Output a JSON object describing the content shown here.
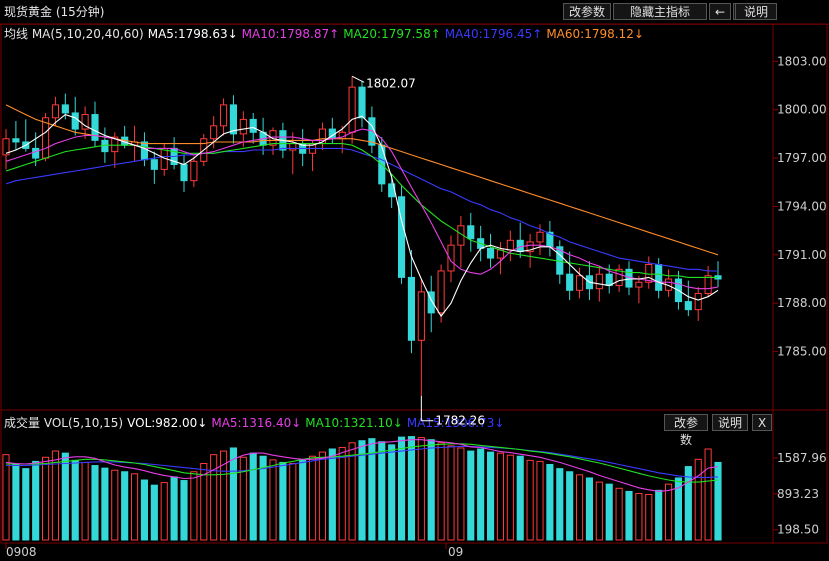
{
  "header": {
    "title": "现货黄金 (15分钟)",
    "buttons": [
      "改参数",
      "隐藏主指标",
      "←",
      "→",
      "说明"
    ]
  },
  "price_legend": {
    "label": "均线 MA(5,10,20,40,60)",
    "items": [
      {
        "text": "MA5:1798.63↓",
        "color": "#ffffff"
      },
      {
        "text": "MA10:1798.87↑",
        "color": "#e63ee6"
      },
      {
        "text": "MA20:1797.58↑",
        "color": "#22e022"
      },
      {
        "text": "MA40:1796.45↑",
        "color": "#3a3aff"
      },
      {
        "text": "MA60:1798.12↓",
        "color": "#ff8c2a"
      }
    ]
  },
  "volume_legend": {
    "label": "成交量 VOL(5,10,15)",
    "items": [
      {
        "text": "VOL:982.00↓",
        "color": "#ffffff"
      },
      {
        "text": "MA5:1316.40↓",
        "color": "#e63ee6"
      },
      {
        "text": "MA10:1321.10↓",
        "color": "#22e022"
      },
      {
        "text": "MA15:1306.73↓",
        "color": "#3a3aff"
      }
    ],
    "buttons": [
      "改参数",
      "说明",
      "X"
    ]
  },
  "chart_data": [
    {
      "type": "candlestick",
      "title": "现货黄金 (15分钟)",
      "y_ticks": [
        "1803.00",
        "1800.00",
        "1797.00",
        "1794.00",
        "1791.00",
        "1788.00",
        "1785.00"
      ],
      "ylim": [
        1781.5,
        1804.2
      ],
      "x_labels": [
        "0908",
        "09"
      ],
      "annotations": [
        "1802.07",
        "1782.26"
      ],
      "ohlc": [
        [
          1797.2,
          1798.8,
          1796.3,
          1798.2
        ],
        [
          1798.2,
          1799.3,
          1797.5,
          1798.0
        ],
        [
          1798.0,
          1799.4,
          1797.4,
          1797.6
        ],
        [
          1797.6,
          1798.6,
          1796.5,
          1797.0
        ],
        [
          1797.0,
          1799.8,
          1796.8,
          1799.5
        ],
        [
          1799.5,
          1800.8,
          1799.0,
          1800.3
        ],
        [
          1800.3,
          1801.0,
          1799.4,
          1799.8
        ],
        [
          1799.8,
          1800.8,
          1798.4,
          1798.8
        ],
        [
          1798.8,
          1800.2,
          1798.2,
          1799.7
        ],
        [
          1799.7,
          1800.5,
          1797.7,
          1798.1
        ],
        [
          1798.1,
          1798.9,
          1796.7,
          1797.4
        ],
        [
          1797.4,
          1798.6,
          1796.4,
          1798.3
        ],
        [
          1798.3,
          1799.0,
          1797.6,
          1797.8
        ],
        [
          1797.8,
          1799.0,
          1796.8,
          1798.0
        ],
        [
          1798.0,
          1798.6,
          1796.5,
          1796.9
        ],
        [
          1796.9,
          1797.4,
          1795.4,
          1796.3
        ],
        [
          1796.3,
          1797.9,
          1795.9,
          1797.6
        ],
        [
          1797.6,
          1798.3,
          1796.3,
          1796.6
        ],
        [
          1796.6,
          1797.2,
          1794.9,
          1795.6
        ],
        [
          1795.6,
          1797.1,
          1795.2,
          1796.8
        ],
        [
          1796.8,
          1798.5,
          1796.5,
          1798.2
        ],
        [
          1798.2,
          1799.6,
          1797.6,
          1799.0
        ],
        [
          1799.0,
          1800.7,
          1798.4,
          1800.3
        ],
        [
          1800.3,
          1800.9,
          1797.9,
          1798.5
        ],
        [
          1798.5,
          1799.9,
          1797.7,
          1799.4
        ],
        [
          1799.4,
          1799.8,
          1797.9,
          1798.6
        ],
        [
          1798.6,
          1799.5,
          1797.2,
          1797.8
        ],
        [
          1797.8,
          1798.9,
          1797.2,
          1798.7
        ],
        [
          1798.7,
          1799.2,
          1797.0,
          1797.5
        ],
        [
          1797.5,
          1798.6,
          1796.0,
          1797.9
        ],
        [
          1797.9,
          1798.8,
          1796.5,
          1797.3
        ],
        [
          1797.3,
          1798.1,
          1796.2,
          1797.9
        ],
        [
          1797.9,
          1799.2,
          1797.5,
          1798.8
        ],
        [
          1798.8,
          1799.5,
          1797.9,
          1798.2
        ],
        [
          1798.2,
          1799.0,
          1797.3,
          1798.6
        ],
        [
          1798.6,
          1802.07,
          1797.9,
          1801.4
        ],
        [
          1801.4,
          1801.8,
          1798.9,
          1799.5
        ],
        [
          1799.5,
          1800.2,
          1797.3,
          1797.8
        ],
        [
          1797.8,
          1798.3,
          1794.9,
          1795.4
        ],
        [
          1795.4,
          1796.0,
          1793.9,
          1794.6
        ],
        [
          1794.6,
          1795.3,
          1789.2,
          1789.6
        ],
        [
          1789.6,
          1791.3,
          1784.9,
          1785.7
        ],
        [
          1785.7,
          1789.5,
          1782.26,
          1788.7
        ],
        [
          1788.7,
          1789.7,
          1786.2,
          1787.4
        ],
        [
          1787.4,
          1790.4,
          1786.8,
          1790.0
        ],
        [
          1790.0,
          1792.2,
          1789.3,
          1791.6
        ],
        [
          1791.6,
          1793.4,
          1790.2,
          1792.8
        ],
        [
          1792.8,
          1793.6,
          1791.2,
          1792.0
        ],
        [
          1792.0,
          1792.8,
          1790.6,
          1791.4
        ],
        [
          1791.4,
          1792.3,
          1790.2,
          1790.8
        ],
        [
          1790.8,
          1791.8,
          1789.8,
          1791.3
        ],
        [
          1791.3,
          1792.5,
          1790.6,
          1791.9
        ],
        [
          1791.9,
          1793.0,
          1790.8,
          1791.2
        ],
        [
          1791.2,
          1792.3,
          1790.2,
          1791.8
        ],
        [
          1791.8,
          1792.9,
          1791.0,
          1792.4
        ],
        [
          1792.4,
          1793.1,
          1790.9,
          1791.5
        ],
        [
          1791.5,
          1791.9,
          1789.2,
          1789.8
        ],
        [
          1789.8,
          1791.2,
          1788.2,
          1788.8
        ],
        [
          1788.8,
          1790.2,
          1788.3,
          1789.7
        ],
        [
          1789.7,
          1790.6,
          1788.2,
          1788.9
        ],
        [
          1788.9,
          1790.3,
          1788.1,
          1789.8
        ],
        [
          1789.8,
          1790.4,
          1788.6,
          1789.1
        ],
        [
          1789.1,
          1790.4,
          1788.7,
          1790.1
        ],
        [
          1790.1,
          1790.6,
          1788.5,
          1789.0
        ],
        [
          1789.0,
          1789.7,
          1788.0,
          1789.3
        ],
        [
          1789.3,
          1790.9,
          1788.9,
          1790.4
        ],
        [
          1790.4,
          1790.8,
          1788.3,
          1788.8
        ],
        [
          1788.8,
          1790.1,
          1788.4,
          1789.5
        ],
        [
          1789.5,
          1790.0,
          1787.6,
          1788.1
        ],
        [
          1788.1,
          1789.4,
          1787.2,
          1787.6
        ],
        [
          1787.6,
          1789.0,
          1786.9,
          1788.6
        ],
        [
          1788.6,
          1790.3,
          1788.4,
          1789.7
        ],
        [
          1789.7,
          1790.6,
          1789.0,
          1789.5
        ]
      ],
      "ma5": [
        1797.3,
        1797.5,
        1797.8,
        1798.2,
        1798.6,
        1799.2,
        1799.7,
        1799.5,
        1799.0,
        1798.7,
        1798.4,
        1798.2,
        1798.0,
        1797.8,
        1797.6,
        1797.3,
        1797.0,
        1796.8,
        1796.6,
        1797.0,
        1797.5,
        1798.0,
        1798.5,
        1798.7,
        1798.8,
        1798.9,
        1798.6,
        1798.2,
        1798.1,
        1798.0,
        1797.8,
        1797.8,
        1798.0,
        1798.4,
        1798.8,
        1799.4,
        1799.6,
        1799.0,
        1797.7,
        1795.8,
        1793.1,
        1790.9,
        1789.5,
        1788.2,
        1787.2,
        1788.0,
        1789.4,
        1790.5,
        1791.4,
        1791.6,
        1791.4,
        1791.3,
        1791.2,
        1791.3,
        1791.5,
        1791.5,
        1791.0,
        1790.4,
        1789.8,
        1789.3,
        1789.2,
        1789.1,
        1789.4,
        1789.5,
        1789.5,
        1789.6,
        1789.3,
        1789.1,
        1788.8,
        1788.4,
        1788.2,
        1788.4,
        1788.8
      ],
      "ma10": [
        1796.8,
        1797.0,
        1797.2,
        1797.4,
        1797.6,
        1797.9,
        1798.1,
        1798.3,
        1798.4,
        1798.4,
        1798.3,
        1798.2,
        1798.0,
        1797.8,
        1797.6,
        1797.6,
        1797.6,
        1797.6,
        1797.4,
        1797.2,
        1797.3,
        1797.4,
        1797.6,
        1797.8,
        1798.0,
        1798.1,
        1798.2,
        1798.3,
        1798.3,
        1798.3,
        1798.2,
        1798.1,
        1798.1,
        1798.2,
        1798.3,
        1798.6,
        1798.8,
        1798.7,
        1798.2,
        1797.4,
        1796.3,
        1795.2,
        1794.1,
        1793.0,
        1791.8,
        1790.6,
        1790.1,
        1789.9,
        1789.8,
        1790.1,
        1790.6,
        1791.2,
        1791.5,
        1791.6,
        1791.6,
        1791.5,
        1791.3,
        1791.0,
        1790.8,
        1790.5,
        1790.3,
        1790.0,
        1789.8,
        1789.6,
        1789.5,
        1789.4,
        1789.3,
        1789.3,
        1789.2,
        1789.0,
        1788.9,
        1788.9,
        1789.0
      ],
      "ma20": [
        1796.2,
        1796.4,
        1796.6,
        1796.8,
        1797.0,
        1797.2,
        1797.4,
        1797.5,
        1797.6,
        1797.7,
        1797.8,
        1797.8,
        1797.8,
        1797.8,
        1797.7,
        1797.6,
        1797.5,
        1797.4,
        1797.3,
        1797.3,
        1797.3,
        1797.3,
        1797.4,
        1797.5,
        1797.6,
        1797.7,
        1797.8,
        1797.9,
        1797.9,
        1797.9,
        1797.9,
        1797.9,
        1797.9,
        1797.9,
        1797.9,
        1797.8,
        1797.5,
        1797.1,
        1796.6,
        1796.0,
        1795.3,
        1794.7,
        1794.1,
        1793.6,
        1793.1,
        1792.7,
        1792.3,
        1791.9,
        1791.7,
        1791.5,
        1791.3,
        1791.1,
        1791.0,
        1790.9,
        1790.8,
        1790.7,
        1790.6,
        1790.5,
        1790.4,
        1790.3,
        1790.2,
        1790.1,
        1790.0,
        1789.9,
        1789.9,
        1789.8,
        1789.8,
        1789.7,
        1789.7,
        1789.6,
        1789.6,
        1789.6,
        1789.6
      ],
      "ma40": [
        1795.4,
        1795.6,
        1795.7,
        1795.8,
        1795.9,
        1796.0,
        1796.1,
        1796.2,
        1796.3,
        1796.4,
        1796.5,
        1796.6,
        1796.7,
        1796.8,
        1796.9,
        1797.0,
        1797.1,
        1797.1,
        1797.2,
        1797.2,
        1797.3,
        1797.3,
        1797.4,
        1797.4,
        1797.4,
        1797.5,
        1797.5,
        1797.5,
        1797.6,
        1797.6,
        1797.6,
        1797.6,
        1797.6,
        1797.6,
        1797.6,
        1797.5,
        1797.3,
        1797.1,
        1796.9,
        1796.6,
        1796.3,
        1796.0,
        1795.7,
        1795.4,
        1795.1,
        1794.9,
        1794.6,
        1794.3,
        1794.1,
        1793.8,
        1793.6,
        1793.3,
        1793.1,
        1792.8,
        1792.6,
        1792.3,
        1792.1,
        1791.8,
        1791.6,
        1791.4,
        1791.2,
        1791.0,
        1790.8,
        1790.7,
        1790.6,
        1790.5,
        1790.4,
        1790.3,
        1790.2,
        1790.1,
        1790.1,
        1790.0,
        1790.0
      ],
      "ma60": [
        1800.3,
        1800.0,
        1799.7,
        1799.4,
        1799.2,
        1799.0,
        1798.8,
        1798.6,
        1798.5,
        1798.4,
        1798.3,
        1798.2,
        1798.1,
        1798.0,
        1797.9,
        1797.9,
        1797.9,
        1797.9,
        1797.9,
        1797.9,
        1797.9,
        1798.0,
        1798.0,
        1798.0,
        1798.0,
        1798.0,
        1798.1,
        1798.1,
        1798.1,
        1798.1,
        1798.1,
        1798.1,
        1798.2,
        1798.2,
        1798.2,
        1798.2,
        1798.1,
        1798.0,
        1797.8,
        1797.6,
        1797.4,
        1797.2,
        1797.0,
        1796.8,
        1796.6,
        1796.4,
        1796.2,
        1796.0,
        1795.8,
        1795.6,
        1795.4,
        1795.2,
        1795.0,
        1794.8,
        1794.6,
        1794.4,
        1794.2,
        1794.0,
        1793.8,
        1793.6,
        1793.4,
        1793.2,
        1793.0,
        1792.8,
        1792.6,
        1792.4,
        1792.2,
        1792.0,
        1791.8,
        1791.6,
        1791.4,
        1791.2,
        1791.0
      ]
    },
    {
      "type": "bar",
      "title": "成交量 VOL(5,10,15)",
      "y_ticks": [
        "1587.96",
        "893.23",
        "198.50"
      ],
      "ylim": [
        0,
        2050
      ],
      "volume": [
        1650,
        1450,
        1380,
        1520,
        1600,
        1720,
        1680,
        1540,
        1500,
        1440,
        1390,
        1350,
        1320,
        1280,
        1160,
        1060,
        1110,
        1220,
        1150,
        1320,
        1480,
        1650,
        1720,
        1780,
        1600,
        1680,
        1620,
        1550,
        1500,
        1480,
        1540,
        1620,
        1700,
        1760,
        1790,
        1880,
        1920,
        1960,
        1900,
        1840,
        1990,
        2000,
        1980,
        1940,
        1880,
        1820,
        1780,
        1720,
        1760,
        1700,
        1680,
        1640,
        1620,
        1540,
        1520,
        1460,
        1380,
        1320,
        1260,
        1200,
        1120,
        1080,
        1000,
        940,
        900,
        880,
        960,
        1080,
        1200,
        1420,
        1560,
        1760,
        1500
      ],
      "bar_colors": "alternating red outline / cyan filled",
      "vol_ma5": [
        1500,
        1480,
        1470,
        1490,
        1520,
        1550,
        1590,
        1610,
        1610,
        1580,
        1510,
        1450,
        1410,
        1380,
        1340,
        1290,
        1250,
        1220,
        1190,
        1200,
        1260,
        1360,
        1460,
        1560,
        1640,
        1680,
        1680,
        1640,
        1610,
        1580,
        1560,
        1560,
        1580,
        1620,
        1690,
        1750,
        1810,
        1860,
        1890,
        1900,
        1920,
        1940,
        1940,
        1920,
        1900,
        1880,
        1850,
        1800,
        1790,
        1750,
        1710,
        1690,
        1660,
        1630,
        1600,
        1550,
        1500,
        1440,
        1380,
        1320,
        1250,
        1190,
        1130,
        1070,
        1010,
        970,
        940,
        960,
        1010,
        1120,
        1240,
        1390,
        1420
      ],
      "vol_ma10": [
        1470,
        1470,
        1470,
        1470,
        1480,
        1500,
        1520,
        1540,
        1560,
        1560,
        1550,
        1530,
        1510,
        1490,
        1460,
        1420,
        1380,
        1340,
        1300,
        1280,
        1260,
        1260,
        1270,
        1290,
        1320,
        1360,
        1400,
        1440,
        1490,
        1520,
        1560,
        1590,
        1600,
        1610,
        1620,
        1640,
        1660,
        1680,
        1710,
        1740,
        1770,
        1800,
        1820,
        1840,
        1850,
        1860,
        1860,
        1850,
        1830,
        1810,
        1790,
        1770,
        1750,
        1720,
        1700,
        1670,
        1640,
        1610,
        1570,
        1530,
        1490,
        1440,
        1390,
        1340,
        1290,
        1240,
        1200,
        1160,
        1130,
        1120,
        1120,
        1140,
        1160
      ],
      "vol_ma15": [
        1440,
        1440,
        1440,
        1450,
        1460,
        1470,
        1480,
        1490,
        1500,
        1510,
        1510,
        1510,
        1500,
        1490,
        1480,
        1460,
        1440,
        1420,
        1400,
        1380,
        1360,
        1340,
        1330,
        1330,
        1340,
        1360,
        1380,
        1410,
        1440,
        1470,
        1500,
        1530,
        1560,
        1580,
        1600,
        1620,
        1640,
        1660,
        1680,
        1700,
        1720,
        1740,
        1760,
        1780,
        1790,
        1800,
        1810,
        1810,
        1800,
        1790,
        1780,
        1770,
        1750,
        1730,
        1710,
        1690,
        1660,
        1630,
        1600,
        1570,
        1540,
        1500,
        1460,
        1420,
        1380,
        1340,
        1300,
        1270,
        1240,
        1220,
        1210,
        1210,
        1220
      ]
    }
  ]
}
